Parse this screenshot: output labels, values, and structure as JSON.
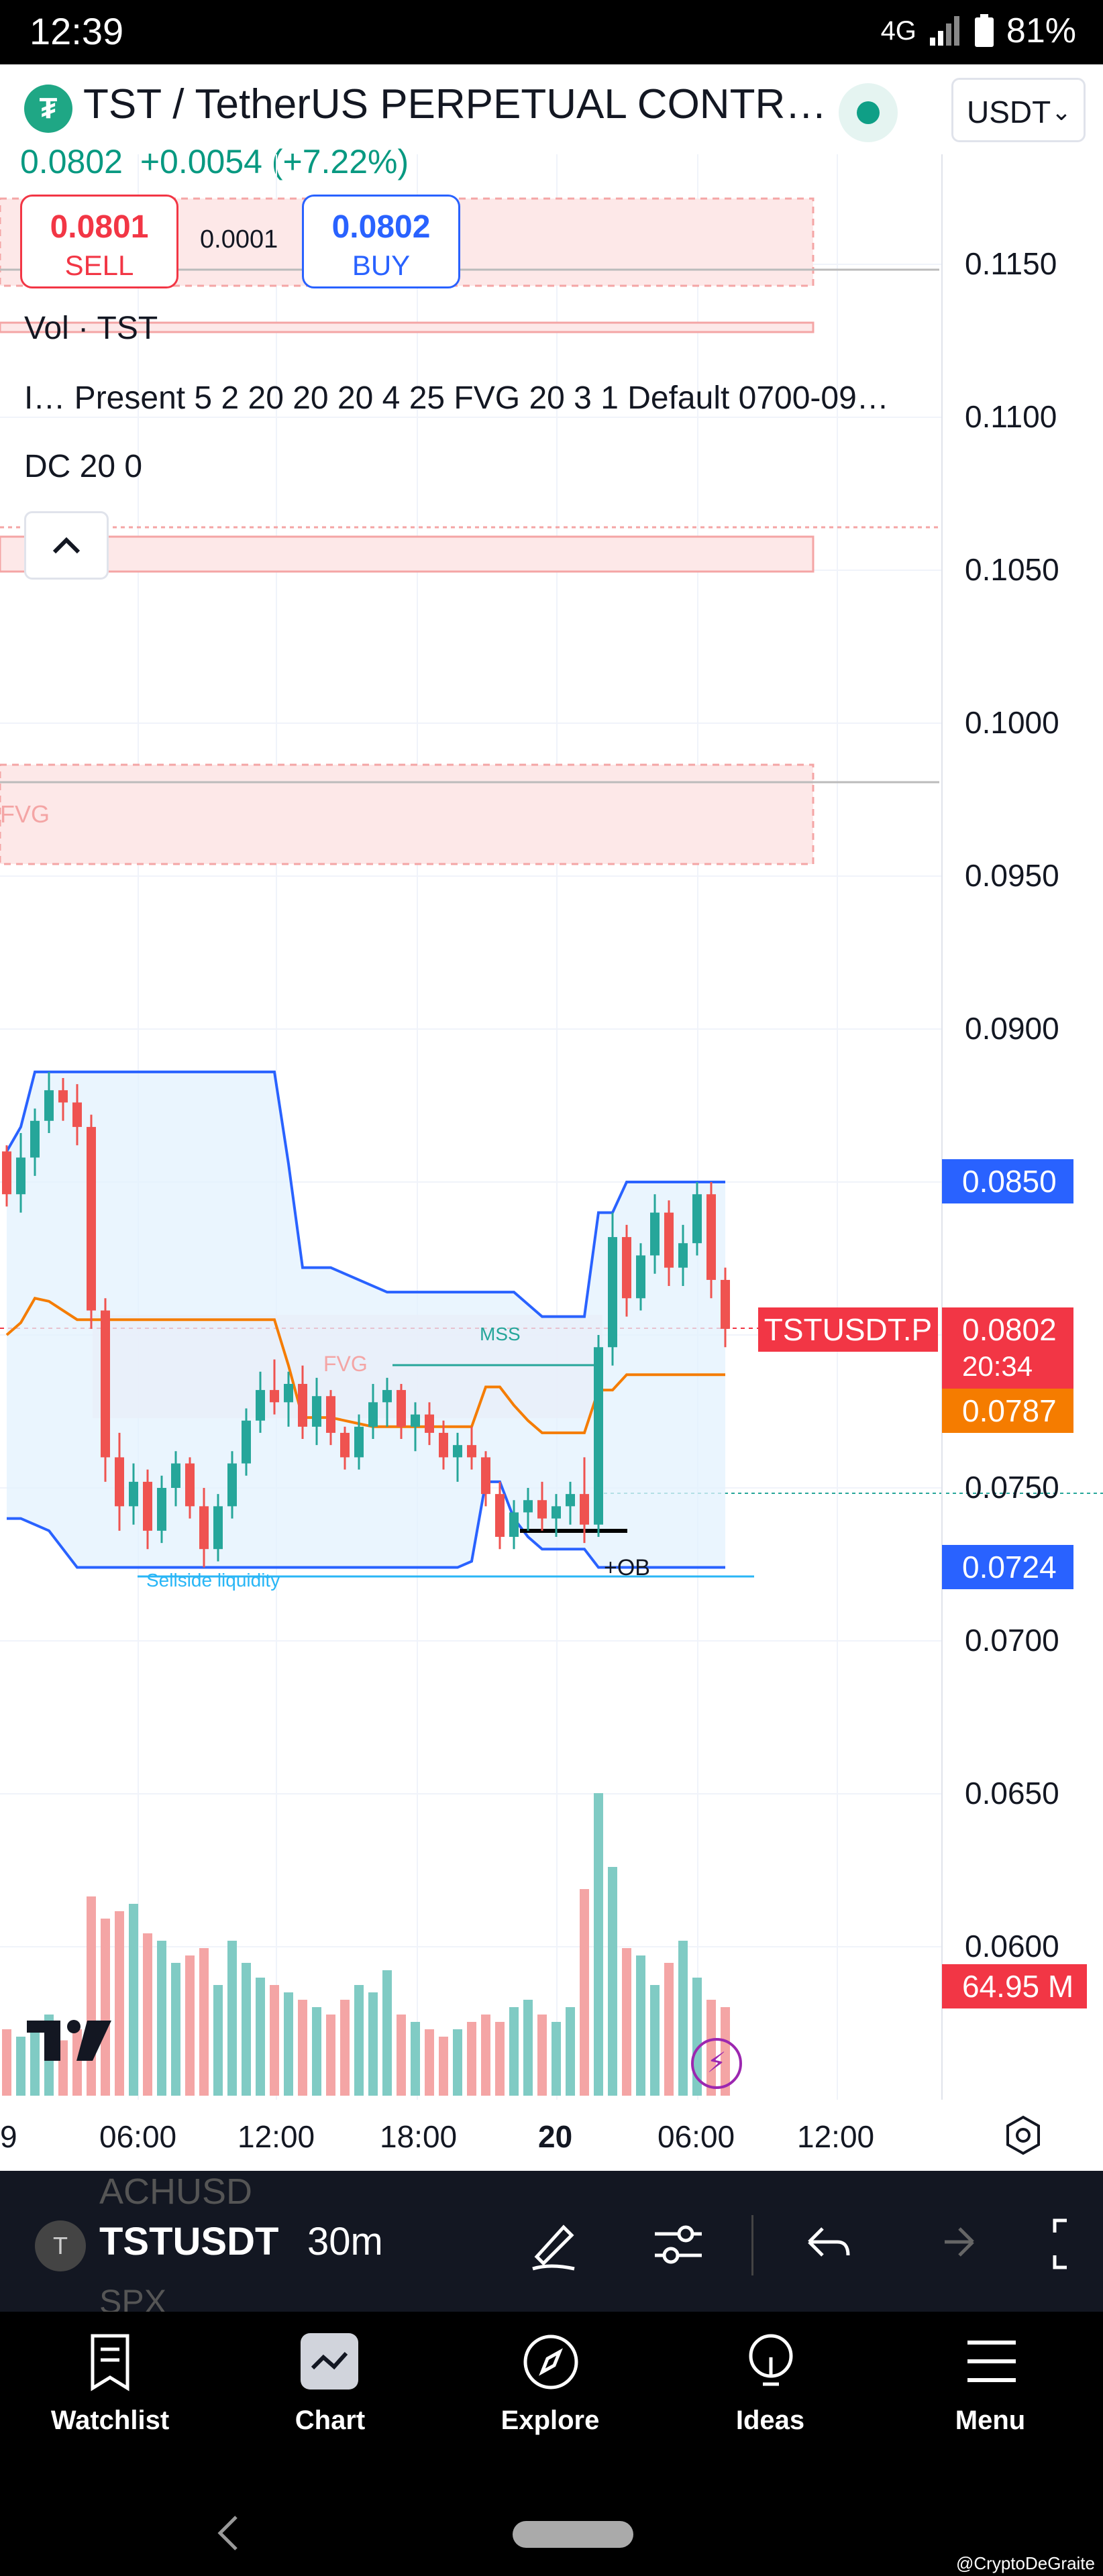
{
  "status_bar": {
    "time": "12:39",
    "network": "4G",
    "battery": "81%"
  },
  "header": {
    "symbol_title": "TST / TetherUS PERPETUAL CONTR…",
    "currency": "USDT",
    "last_price": "0.0802",
    "change": "+0.0054 (+7.22%)"
  },
  "trade": {
    "sell_price": "0.0801",
    "sell_label": "SELL",
    "spread": "0.0001",
    "buy_price": "0.0802",
    "buy_label": "BUY"
  },
  "legend": {
    "vol": "Vol · TST",
    "indicator": "I…  Present 5 2 20 20 20 4 25 FVG 20 3 1 Default 0700-09…",
    "dc": "DC 20 0"
  },
  "price_axis": [
    "0.1150",
    "0.1100",
    "0.1050",
    "0.1000",
    "0.0950",
    "0.0900",
    "0.0850",
    "0.0800",
    "0.0750",
    "0.0700",
    "0.0650",
    "0.0600"
  ],
  "price_tags": {
    "dc_upper": "0.0850",
    "symbol_label": "TSTUSDT.P",
    "current": "0.0802",
    "countdown": "20:34",
    "dc_mid": "0.0787",
    "dc_lower": "0.0724",
    "volume": "64.95 M"
  },
  "time_axis": [
    "9",
    "06:00",
    "12:00",
    "18:00",
    "20",
    "06:00",
    "12:00"
  ],
  "annotations": {
    "fvg_top": "FVG",
    "fvg_mid": "FVG",
    "mss": "MSS",
    "sellside": "Sellside liquidity",
    "ob": "+OB"
  },
  "chart_data": {
    "type": "candlestick",
    "ylim": [
      0.057,
      0.1185
    ],
    "candles": [
      [
        0.086,
        0.0862,
        0.0842,
        0.0846
      ],
      [
        0.0846,
        0.0866,
        0.084,
        0.0858
      ],
      [
        0.0858,
        0.0874,
        0.0852,
        0.087
      ],
      [
        0.087,
        0.0886,
        0.0866,
        0.088
      ],
      [
        0.088,
        0.0884,
        0.087,
        0.0876
      ],
      [
        0.0876,
        0.0882,
        0.0862,
        0.0868
      ],
      [
        0.0868,
        0.0872,
        0.0802,
        0.0808
      ],
      [
        0.0808,
        0.0812,
        0.0752,
        0.076
      ],
      [
        0.076,
        0.0768,
        0.0736,
        0.0744
      ],
      [
        0.0744,
        0.0758,
        0.0738,
        0.0752
      ],
      [
        0.0752,
        0.0756,
        0.073,
        0.0736
      ],
      [
        0.0736,
        0.0754,
        0.0732,
        0.075
      ],
      [
        0.075,
        0.0762,
        0.0744,
        0.0758
      ],
      [
        0.0758,
        0.076,
        0.074,
        0.0744
      ],
      [
        0.0744,
        0.075,
        0.0724,
        0.073
      ],
      [
        0.073,
        0.0748,
        0.0726,
        0.0744
      ],
      [
        0.0744,
        0.0762,
        0.074,
        0.0758
      ],
      [
        0.0758,
        0.0776,
        0.0754,
        0.0772
      ],
      [
        0.0772,
        0.0788,
        0.0768,
        0.0782
      ],
      [
        0.0782,
        0.0792,
        0.0774,
        0.0778
      ],
      [
        0.0778,
        0.0788,
        0.077,
        0.0784
      ],
      [
        0.0784,
        0.079,
        0.0766,
        0.077
      ],
      [
        0.077,
        0.0786,
        0.0764,
        0.078
      ],
      [
        0.078,
        0.0782,
        0.0764,
        0.0768
      ],
      [
        0.0768,
        0.077,
        0.0756,
        0.076
      ],
      [
        0.076,
        0.0774,
        0.0756,
        0.077
      ],
      [
        0.077,
        0.0784,
        0.0766,
        0.0778
      ],
      [
        0.0778,
        0.0786,
        0.077,
        0.0782
      ],
      [
        0.0782,
        0.0784,
        0.0766,
        0.077
      ],
      [
        0.077,
        0.0778,
        0.0762,
        0.0774
      ],
      [
        0.0774,
        0.0778,
        0.0764,
        0.0768
      ],
      [
        0.0768,
        0.0772,
        0.0756,
        0.076
      ],
      [
        0.076,
        0.0768,
        0.0752,
        0.0764
      ],
      [
        0.0764,
        0.077,
        0.0756,
        0.076
      ],
      [
        0.076,
        0.0762,
        0.0744,
        0.0748
      ],
      [
        0.0748,
        0.0752,
        0.073,
        0.0734
      ],
      [
        0.0734,
        0.0746,
        0.073,
        0.0742
      ],
      [
        0.0742,
        0.075,
        0.0736,
        0.0746
      ],
      [
        0.0746,
        0.0752,
        0.0736,
        0.074
      ],
      [
        0.074,
        0.0748,
        0.0734,
        0.0744
      ],
      [
        0.0744,
        0.0752,
        0.0738,
        0.0748
      ],
      [
        0.0748,
        0.076,
        0.0732,
        0.0738
      ],
      [
        0.0738,
        0.08,
        0.0734,
        0.0796
      ],
      [
        0.0796,
        0.084,
        0.079,
        0.0832
      ],
      [
        0.0832,
        0.0836,
        0.0806,
        0.0812
      ],
      [
        0.0812,
        0.083,
        0.0808,
        0.0826
      ],
      [
        0.0826,
        0.0846,
        0.082,
        0.084
      ],
      [
        0.084,
        0.0844,
        0.0816,
        0.0822
      ],
      [
        0.0822,
        0.0836,
        0.0816,
        0.083
      ],
      [
        0.083,
        0.085,
        0.0826,
        0.0846
      ],
      [
        0.0846,
        0.085,
        0.0812,
        0.0818
      ],
      [
        0.0818,
        0.0822,
        0.0796,
        0.0802
      ]
    ],
    "volume": [
      18,
      16,
      20,
      22,
      15,
      18,
      54,
      48,
      50,
      52,
      44,
      42,
      36,
      38,
      40,
      30,
      42,
      36,
      32,
      30,
      28,
      26,
      24,
      22,
      26,
      30,
      28,
      34,
      22,
      20,
      18,
      16,
      18,
      20,
      22,
      20,
      24,
      26,
      22,
      20,
      24,
      56,
      82,
      62,
      40,
      38,
      30,
      36,
      42,
      32,
      26,
      24
    ],
    "dc_upper": [
      0.086,
      0.0868,
      0.0886,
      0.0886,
      0.0886,
      0.0886,
      0.0886,
      0.0886,
      0.0886,
      0.0886,
      0.0886,
      0.0886,
      0.0886,
      0.0886,
      0.0886,
      0.0886,
      0.0886,
      0.0886,
      0.0886,
      0.0886,
      0.0856,
      0.0822,
      0.0822,
      0.0822,
      0.082,
      0.0818,
      0.0816,
      0.0814,
      0.0814,
      0.0814,
      0.0814,
      0.0814,
      0.0814,
      0.0814,
      0.0814,
      0.0814,
      0.0814,
      0.081,
      0.0806,
      0.0806,
      0.0806,
      0.0806,
      0.084,
      0.084,
      0.085,
      0.085,
      0.085,
      0.085,
      0.085,
      0.085,
      0.085,
      0.085
    ],
    "dc_lower": [
      0.074,
      0.074,
      0.0738,
      0.0736,
      0.073,
      0.0724,
      0.0724,
      0.0724,
      0.0724,
      0.0724,
      0.0724,
      0.0724,
      0.0724,
      0.0724,
      0.0724,
      0.0724,
      0.0724,
      0.0724,
      0.0724,
      0.0724,
      0.0724,
      0.0724,
      0.0724,
      0.0724,
      0.0724,
      0.0724,
      0.0724,
      0.0724,
      0.0724,
      0.0724,
      0.0724,
      0.0724,
      0.0724,
      0.0726,
      0.0752,
      0.0752,
      0.074,
      0.0734,
      0.073,
      0.073,
      0.073,
      0.073,
      0.0724,
      0.0724,
      0.0724,
      0.0724,
      0.0724,
      0.0724,
      0.0724,
      0.0724,
      0.0724,
      0.0724
    ],
    "dc_mid": [
      0.08,
      0.0804,
      0.0812,
      0.0811,
      0.0808,
      0.0805,
      0.0805,
      0.0805,
      0.0805,
      0.0805,
      0.0805,
      0.0805,
      0.0805,
      0.0805,
      0.0805,
      0.0805,
      0.0805,
      0.0805,
      0.0805,
      0.0805,
      0.079,
      0.0773,
      0.0773,
      0.0773,
      0.0772,
      0.0771,
      0.077,
      0.077,
      0.077,
      0.077,
      0.077,
      0.077,
      0.077,
      0.077,
      0.0783,
      0.0783,
      0.0777,
      0.0772,
      0.0768,
      0.0768,
      0.0768,
      0.0768,
      0.0782,
      0.0782,
      0.0787,
      0.0787,
      0.0787,
      0.0787,
      0.0787,
      0.0787,
      0.0787,
      0.0787
    ]
  },
  "toolbar": {
    "symbol": "TSTUSDT",
    "interval": "30m",
    "ghost_top": "ACHUSD",
    "ghost_bottom": "SPX"
  },
  "nav": [
    "Watchlist",
    "Chart",
    "Explore",
    "Ideas",
    "Menu"
  ],
  "credit": "@CryptoDeGraite",
  "colors": {
    "up": "#26a69a",
    "down": "#ef5350",
    "dc_band": "#2962ff",
    "dc_mid": "#f57c00",
    "sell": "#f23645",
    "buy": "#2962ff"
  }
}
